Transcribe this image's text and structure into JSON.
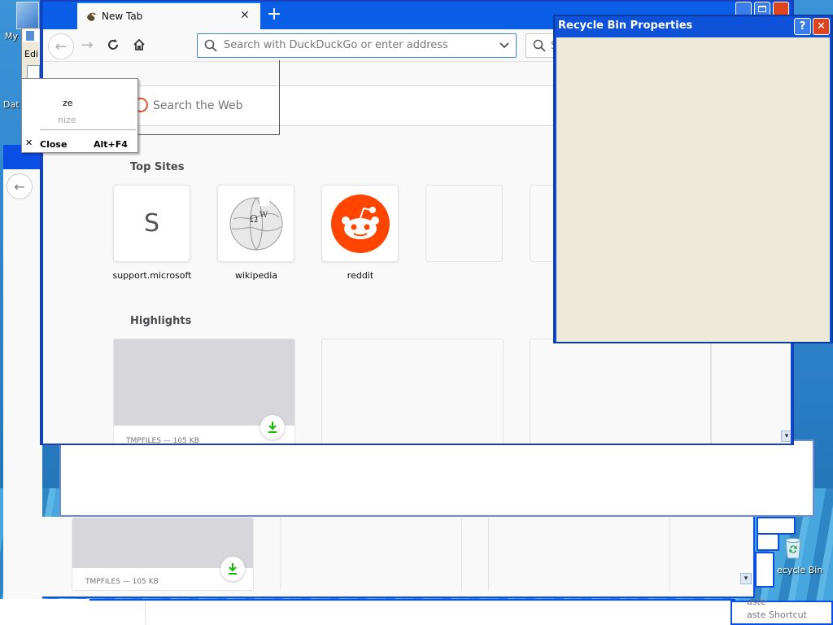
{
  "browser": {
    "tab_title": "New Tab",
    "url_placeholder": "Search with DuckDuckGo or enter address",
    "search_box_placeholder": "S",
    "web_search_placeholder": "Search the Web",
    "top_sites_title": "Top Sites",
    "top_sites": [
      {
        "label": "support.microsoft",
        "letter": "S"
      },
      {
        "label": "wikipedia"
      },
      {
        "label": "reddit"
      }
    ],
    "highlights_title": "Highlights",
    "highlight_meta": "TMPFILES — 105 KB"
  },
  "back_browser": {
    "highlight_meta": "TMPFILES — 105 KB"
  },
  "recycle_bin_props": {
    "title": "Recycle Bin Properties",
    "help_label": "?",
    "close_label": "✕"
  },
  "context_menu": {
    "items": [
      {
        "label": "ze"
      },
      {
        "label": "nize"
      },
      {
        "label": "Close",
        "shortcut": "Alt+F4"
      }
    ]
  },
  "desktop": {
    "my_label": "My",
    "edit_label": "Edi",
    "dat_label": "Dat",
    "recycle_bin_label": "ecycle Bin",
    "paste_label": "aste",
    "paste_shortcut_label": "aste Shortcut"
  },
  "colors": {
    "xp_blue": "#0a4ee6",
    "accent": "#0a84ff",
    "reddit": "#ff4500",
    "download_green": "#12bc00"
  }
}
